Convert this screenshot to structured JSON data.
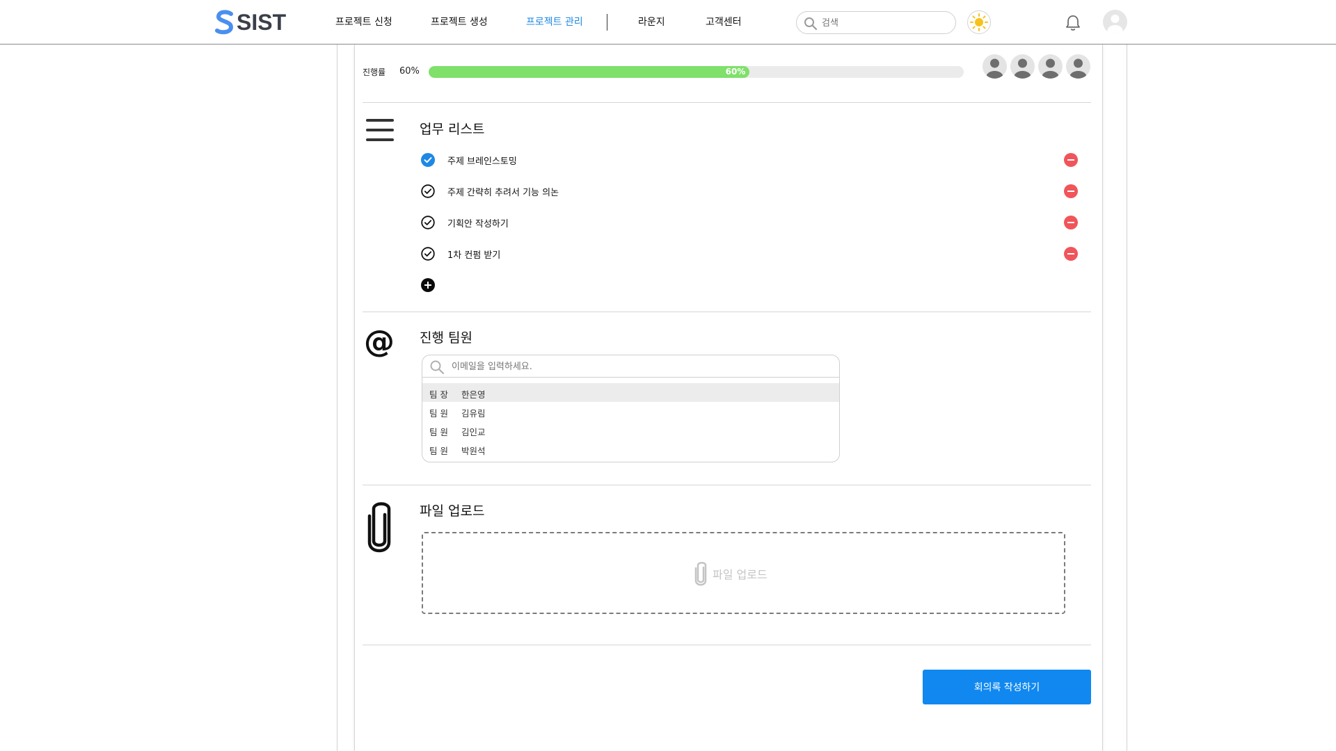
{
  "brand": {
    "name": "SIST",
    "accent": "#1e88e5",
    "logo_color": "#4a8ff0"
  },
  "nav": [
    {
      "label": "프로젝트 신청",
      "active": false
    },
    {
      "label": "프로젝트 생성",
      "active": false
    },
    {
      "label": "프로젝트 관리",
      "active": true
    },
    {
      "label": "라운지",
      "active": false
    },
    {
      "label": "고객센터",
      "active": false
    }
  ],
  "search": {
    "placeholder": "검색",
    "icon": "search-icon"
  },
  "header_icons": {
    "theme": "sun-icon",
    "notifications": "bell-icon",
    "profile": "user-avatar-icon"
  },
  "progress": {
    "label": "진행률",
    "value": "60%",
    "bar_text": "60%",
    "fraction": 0.6,
    "color": "#7fe06a"
  },
  "members_count": 4,
  "tasks_section": {
    "title": "업무 리스트",
    "icon": "menu-lines-icon",
    "items": [
      {
        "label": "주제 브레인스토밍",
        "done": true
      },
      {
        "label": "주제 간략히 추려서 기능 의논",
        "done": false
      },
      {
        "label": "기획안 작성하기",
        "done": false
      },
      {
        "label": "1차 컨펌 받기",
        "done": false
      }
    ],
    "remove_color": "#f0555a"
  },
  "team_section": {
    "title": "진행 팀원",
    "icon": "at-sign-icon",
    "search_placeholder": "이메일을 입력하세요.",
    "members": [
      {
        "role": "팀 장",
        "name": "한은영"
      },
      {
        "role": "팀 원",
        "name": "김유림"
      },
      {
        "role": "팀 원",
        "name": "김인교"
      },
      {
        "role": "팀 원",
        "name": "박원석"
      }
    ]
  },
  "upload_section": {
    "title": "파일 업로드",
    "icon": "paperclip-icon",
    "zone_label": "파일 업로드"
  },
  "submit": {
    "label": "회의록 작성하기",
    "color": "#1088f0"
  }
}
